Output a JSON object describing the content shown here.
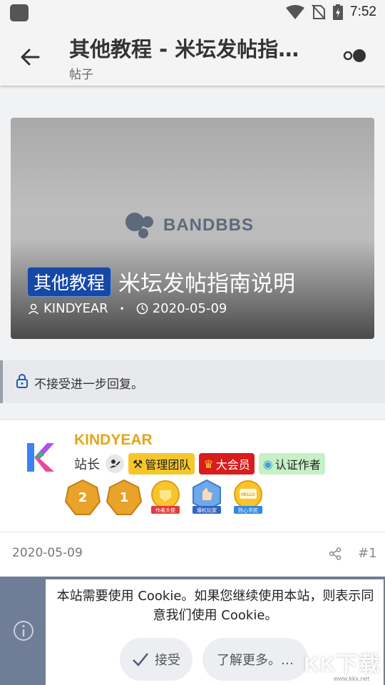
{
  "status_bar": {
    "time": "7:52"
  },
  "app_bar": {
    "title": "其他教程 - 米坛发帖指南…",
    "subtitle": "帖子"
  },
  "cover": {
    "logo_text": "BANDBBS",
    "category": "其他教程",
    "title": "米坛发帖指南说明",
    "author": "KINDYEAR",
    "date": "2020-05-09"
  },
  "notice": {
    "text": "不接受进一步回复。"
  },
  "post": {
    "author": "KINDYEAR",
    "role": "站长",
    "tags": [
      "管理团队",
      "大会员",
      "认证作者"
    ],
    "medals": [
      {
        "label": "2",
        "caption": ""
      },
      {
        "label": "1",
        "caption": ""
      },
      {
        "label": "",
        "caption": "作者大使"
      },
      {
        "label": "",
        "caption": "爆机玩家"
      },
      {
        "label": "HELLO",
        "caption": "热心市民"
      }
    ],
    "date": "2020-05-09",
    "number": "#1"
  },
  "cookie": {
    "text": "本站需要使用 Cookie。如果您继续使用本站，则表示同意我们使用 Cookie。",
    "accept_label": "接受",
    "more_label": "了解更多。…"
  },
  "watermark": {
    "text": "KK下载",
    "url": "www.kkx.net"
  },
  "colors": {
    "category_badge": "#1648a7",
    "author_name": "#e6a516",
    "tag_admin": "#f6c62a",
    "tag_vip": "#d91c1c",
    "tag_author": "#c6f0c6",
    "cookie_backdrop": "#6f7d97"
  }
}
